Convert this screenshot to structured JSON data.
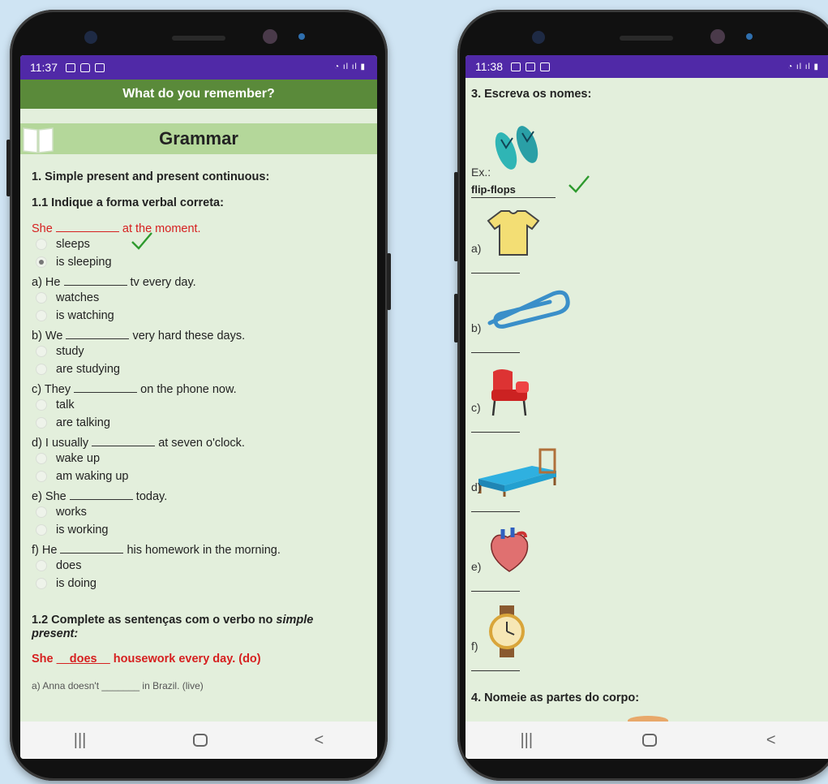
{
  "left": {
    "status": {
      "time": "11:37"
    },
    "appbar_title": "What do you remember?",
    "section_title": "Grammar",
    "heading1": "1. Simple present and present continuous:",
    "heading11": "1.1 Indique a forma verbal correta:",
    "example": {
      "subject": "She",
      "rest": "at the moment.",
      "options": [
        "sleeps",
        "is sleeping"
      ],
      "selected": 1
    },
    "questions": [
      {
        "subject": "a) He",
        "rest": "tv every day.",
        "options": [
          "watches",
          "is watching"
        ]
      },
      {
        "subject": "b) We",
        "rest": "very hard these days.",
        "options": [
          "study",
          "are studying"
        ]
      },
      {
        "subject": "c) They",
        "rest": "on the phone now.",
        "options": [
          "talk",
          "are talking"
        ]
      },
      {
        "subject": "d) I usually",
        "rest": "at seven o'clock.",
        "options": [
          "wake up",
          "am waking up"
        ]
      },
      {
        "subject": "e) She",
        "rest": "today.",
        "options": [
          "works",
          "is working"
        ]
      },
      {
        "subject": "f) He",
        "rest": "his homework in the morning.",
        "options": [
          "does",
          "is doing"
        ]
      }
    ],
    "heading12_a": "1.2 Complete as sentenças com o verbo no",
    "heading12_em": "simple",
    "heading12_b": "present:",
    "example2": {
      "subject": "She",
      "answer": "does",
      "rest": "housework every day. (do)"
    },
    "cut_line": "a) Anna doesn't _______ in Brazil. (live)"
  },
  "right": {
    "status": {
      "time": "11:38"
    },
    "heading3": "3. Escreva os nomes:",
    "ex_label": "Ex.:",
    "ex_answer": "flip-flops",
    "items": [
      {
        "label": "a)",
        "icon": "tshirt-icon"
      },
      {
        "label": "b)",
        "icon": "paperclip-icon"
      },
      {
        "label": "c)",
        "icon": "armchair-icon"
      },
      {
        "label": "d)",
        "icon": "bed-icon"
      },
      {
        "label": "e)",
        "icon": "heart-organ-icon"
      },
      {
        "label": "f)",
        "icon": "wristwatch-icon"
      }
    ],
    "heading4": "4. Nomeie as partes do corpo:"
  },
  "colors": {
    "accent_purple": "#5029a7",
    "appbar_green": "#5a8a3a",
    "banner_green": "#b4d79a",
    "screen_bg": "#e3efdc",
    "red_text": "#d62020",
    "check_green": "#2e9a2e"
  }
}
